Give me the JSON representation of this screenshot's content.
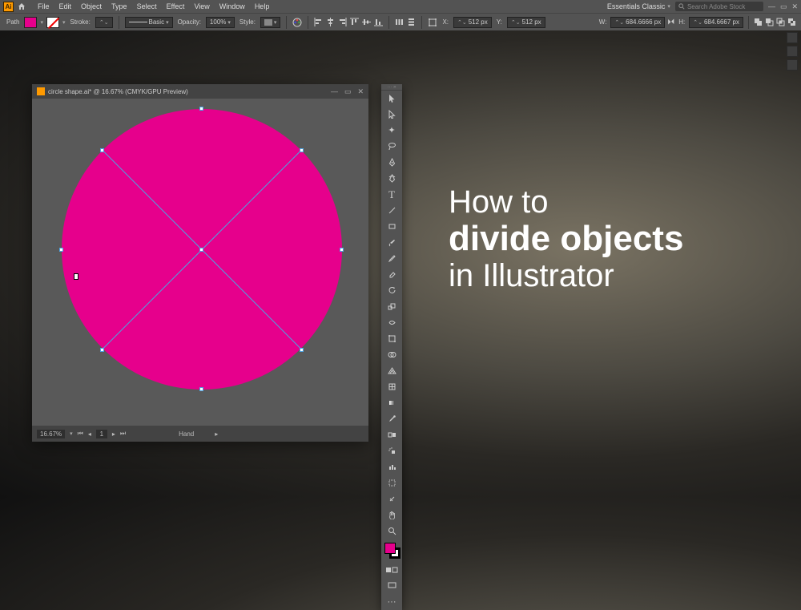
{
  "menubar": {
    "items": [
      "File",
      "Edit",
      "Object",
      "Type",
      "Select",
      "Effect",
      "View",
      "Window",
      "Help"
    ],
    "workspace": "Essentials Classic",
    "search_placeholder": "Search Adobe Stock"
  },
  "controlbar": {
    "path": "Path",
    "stroke": "Stroke:",
    "brush": "Basic",
    "opacity": "Opacity:",
    "opacity_val": "100%",
    "style": "Style:",
    "x_lbl": "X:",
    "x_val": "512 px",
    "y_lbl": "Y:",
    "y_val": "512 px",
    "w_lbl": "W:",
    "w_val": "684.6666 px",
    "h_lbl": "H:",
    "h_val": "684.6667 px"
  },
  "doc": {
    "title": "circle shape.ai* @ 16.67% (CMYK/GPU Preview)",
    "zoom": "16.67%",
    "tool": "Hand"
  },
  "toolbox": {
    "tools": [
      "selection",
      "direct-selection",
      "magic-wand",
      "lasso",
      "pen",
      "curvature",
      "type",
      "line",
      "rectangle",
      "paintbrush",
      "pencil",
      "eraser",
      "rotate",
      "scale",
      "width",
      "free-transform",
      "shape-builder",
      "perspective",
      "mesh",
      "gradient",
      "eyedropper",
      "blend",
      "symbol-sprayer",
      "column-graph",
      "artboard",
      "slice",
      "hand",
      "zoom"
    ]
  },
  "overlay": {
    "line1": "How to",
    "line2": "divide objects",
    "line3": "in Illustrator"
  },
  "colors": {
    "accent": "#e6008c",
    "select": "#4fa3e0"
  }
}
